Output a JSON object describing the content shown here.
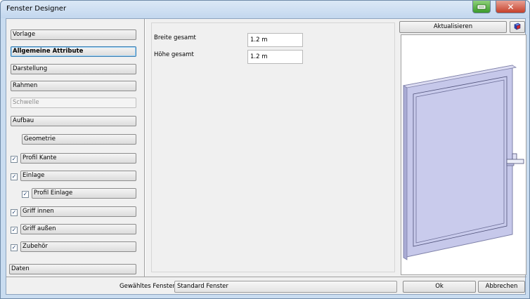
{
  "window": {
    "title": "Fenster Designer"
  },
  "sidebar": {
    "vorlage": "Vorlage",
    "allgemeine": "Allgemeine Attribute",
    "darstellung": "Darstellung",
    "rahmen": "Rahmen",
    "schwelle": "Schwelle",
    "aufbau": "Aufbau",
    "geometrie": "Geometrie",
    "profil_kante": {
      "label": "Profil Kante",
      "checked": true
    },
    "einlage": {
      "label": "Einlage",
      "checked": true
    },
    "profil_einlage": {
      "label": "Profil Einlage",
      "checked": true
    },
    "griff_innen": {
      "label": "Griff innen",
      "checked": true
    },
    "griff_aussen": {
      "label": "Griff außen",
      "checked": true
    },
    "zubehoer": {
      "label": "Zubehör",
      "checked": true
    },
    "daten": "Daten"
  },
  "attributes": {
    "breite_label": "Breite gesamt",
    "breite_value": "1.2 m",
    "hoehe_label": "Höhe gesamt",
    "hoehe_value": "1.2 m"
  },
  "preview": {
    "refresh_label": "Aktualisieren",
    "view_icon": "3d-cube-icon"
  },
  "footer": {
    "selected_label": "Gewähltes Fenster",
    "selected_value": "Standard Fenster",
    "ok_label": "Ok",
    "cancel_label": "Abbrechen"
  },
  "colors": {
    "window_face": "#c6c8ea",
    "window_edge": "#7e80a8",
    "active_border": "#3c7fb1"
  }
}
